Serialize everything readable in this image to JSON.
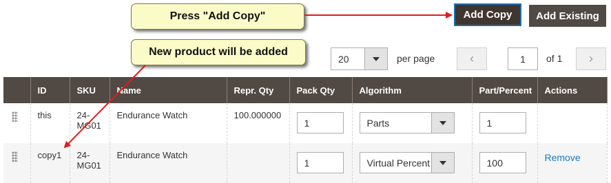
{
  "callouts": {
    "add_copy": "Press \"Add Copy\"",
    "new_product": "New product will be added"
  },
  "buttons": {
    "add_copy": "Add Copy",
    "add_existing": "Add Existing"
  },
  "pager": {
    "per_page_value": "20",
    "per_page_label": "per page",
    "current_page": "1",
    "total_label": "of 1",
    "prev_icon": "‹",
    "next_icon": "›"
  },
  "table": {
    "headers": [
      "",
      "ID",
      "SKU",
      "Name",
      "Repr. Qty",
      "Pack Qty",
      "Algorithm",
      "Part/Percent",
      "Actions"
    ],
    "rows": [
      {
        "id": "this",
        "sku": "24-MG01",
        "name": "Endurance Watch",
        "repr_qty": "100.000000",
        "pack_qty": "1",
        "algorithm": "Parts",
        "part_percent": "1",
        "action": ""
      },
      {
        "id": "copy1",
        "sku": "24-MG01",
        "name": "Endurance Watch",
        "repr_qty": "",
        "pack_qty": "1",
        "algorithm": "Virtual Percent",
        "part_percent": "100",
        "action": "Remove"
      }
    ]
  },
  "colors": {
    "header_bg": "#514943",
    "callout_bg": "#fbfbc8",
    "arrow": "#e01b1b",
    "link": "#1979c3"
  }
}
